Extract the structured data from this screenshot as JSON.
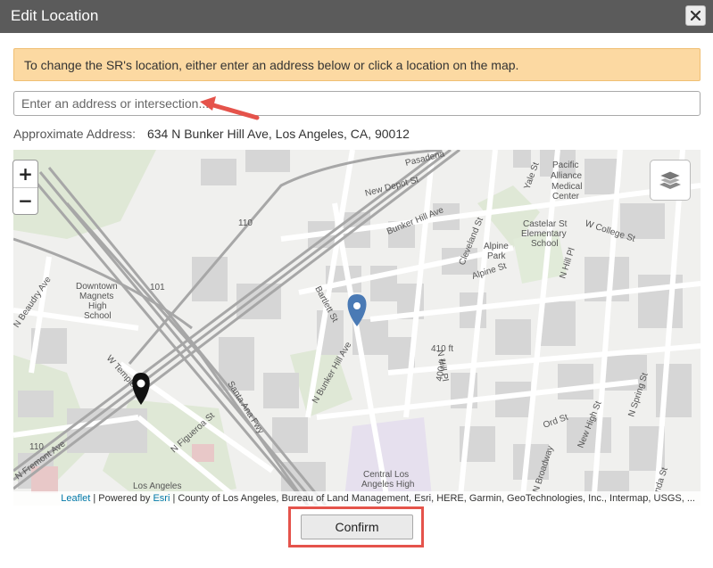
{
  "dialog": {
    "title": "Edit Location",
    "close_symbol": "×",
    "notice": "To change the SR's location, either enter an address below or click a location on the map.",
    "address_placeholder": "Enter an address or intersection...",
    "approx_label": "Approximate Address:",
    "approx_value": "634 N Bunker Hill Ave, Los Angeles, CA, 90012",
    "confirm_label": "Confirm"
  },
  "map": {
    "zoom_in": "+",
    "zoom_out": "−",
    "labels": {
      "pasadena": "Pasadena",
      "new_depot": "New Depot St",
      "bunker_hill_ave": "Bunker Hill Ave",
      "cleveland": "Cleveland St",
      "alpine_st": "Alpine St",
      "alpine_park_1": "Alpine",
      "alpine_park_2": "Park",
      "pacific_1": "Pacific",
      "pacific_2": "Alliance",
      "pacific_3": "Medical",
      "pacific_4": "Center",
      "castelar_1": "Castelar St",
      "castelar_2": "Elementary",
      "castelar_3": "School",
      "w_college": "W College St",
      "n_hill_pl_right": "N Hill Pl",
      "n_hill_pl": "N Hill Pl",
      "yale": "Yale St",
      "hwy_110_top": "110",
      "hwy_101": "101",
      "hwy_110_bottom": "110",
      "downtown_1": "Downtown",
      "downtown_2": "Magnets",
      "downtown_3": "High",
      "downtown_4": "School",
      "n_beaudry": "N Beaudry Ave",
      "bartlett": "Bartlett St",
      "n_bunker_hill": "N Bunker Hill Ave",
      "ft_410": "410 ft",
      "ft_400": "400 ft",
      "w_temple": "W Temple St",
      "n_figueroa": "N Figueroa St",
      "santa_ana": "Santa Ana Fwy",
      "n_fremont": "N Fremont Ave",
      "la_1": "Los Angeles",
      "central_1": "Central Los",
      "central_2": "Angeles High",
      "ord": "Ord St",
      "new_high": "New High St",
      "n_broadway": "N Broadway",
      "n_spring": "N Spring St",
      "nda": "nda St"
    },
    "attribution_link": "Leaflet",
    "attribution_powered": " | Powered by ",
    "attribution_esri": "Esri",
    "attribution_rest": " | County of Los Angeles, Bureau of Land Management, Esri, HERE, Garmin, GeoTechnologies, Inc., Intermap, USGS, ..."
  },
  "colors": {
    "pin_blue": "#4a7ab5",
    "pin_black": "#111111",
    "highlight": "#e5534b"
  }
}
